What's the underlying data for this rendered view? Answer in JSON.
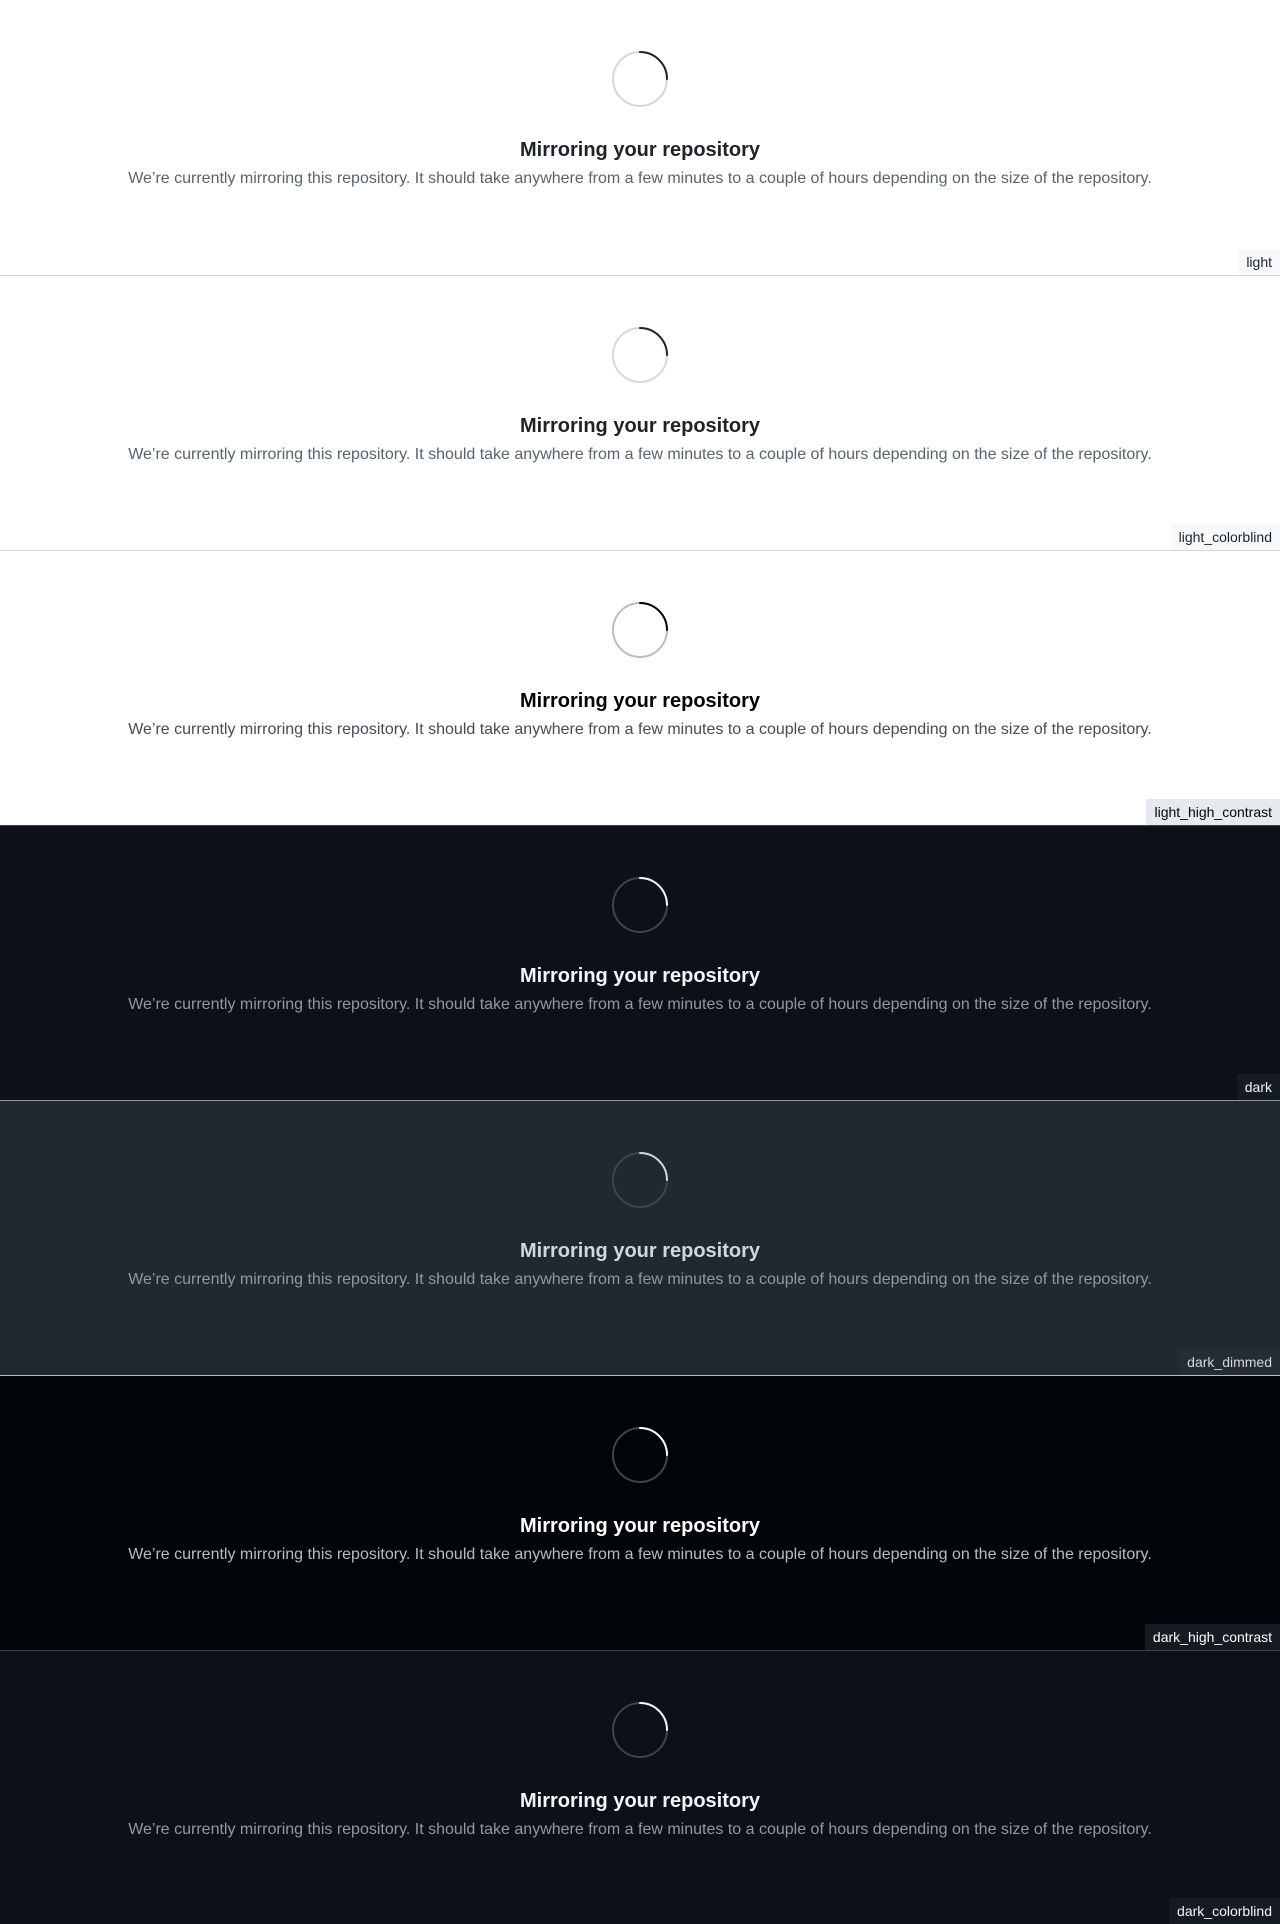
{
  "blankslate": {
    "title": "Mirroring your repository",
    "description": "We’re currently mirroring this repository. It should take anywhere from a few minutes to a couple of hours depending on the size of the repository.",
    "icon": "spinner-icon"
  },
  "themes": [
    {
      "name": "light",
      "colors": {
        "bg": "#ffffff",
        "title": "#1f2328",
        "desc": "#59636e",
        "track": "#d1d9e0",
        "arc": "#1f2328",
        "tagbg": "#f6f8fa",
        "tagfg": "#1f2328",
        "divider": "#d1d9e0"
      }
    },
    {
      "name": "light_colorblind",
      "colors": {
        "bg": "#ffffff",
        "title": "#1f2328",
        "desc": "#59636e",
        "track": "#d1d9e0",
        "arc": "#1f2328",
        "tagbg": "#f6f8fa",
        "tagfg": "#1f2328",
        "divider": "#d1d9e0"
      }
    },
    {
      "name": "light_high_contrast",
      "colors": {
        "bg": "#ffffff",
        "title": "#010409",
        "desc": "#454c54",
        "track": "#b7bdc8",
        "arc": "#010409",
        "tagbg": "#e6eaef",
        "tagfg": "#010409",
        "divider": "#d1d9e0"
      }
    },
    {
      "name": "dark",
      "colors": {
        "bg": "#0d1117",
        "title": "#f0f6fc",
        "desc": "#9198a1",
        "track": "#3d444d",
        "arc": "#f0f6fc",
        "tagbg": "#151b23",
        "tagfg": "#f0f6fc",
        "divider": "#3d444d"
      }
    },
    {
      "name": "dark_dimmed",
      "colors": {
        "bg": "#212830",
        "title": "#d1d7e0",
        "desc": "#9198a1",
        "track": "#3d444d",
        "arc": "#d1d7e0",
        "tagbg": "#262c36",
        "tagfg": "#d1d7e0",
        "divider": "#9198a1"
      }
    },
    {
      "name": "dark_high_contrast",
      "colors": {
        "bg": "#010409",
        "title": "#ffffff",
        "desc": "#b7bdc8",
        "track": "#3d444d",
        "arc": "#ffffff",
        "tagbg": "#151b23",
        "tagfg": "#ffffff",
        "divider": "#b7bdc8"
      }
    },
    {
      "name": "dark_colorblind",
      "colors": {
        "bg": "#0d1117",
        "title": "#f0f6fc",
        "desc": "#9198a1",
        "track": "#3d444d",
        "arc": "#f0f6fc",
        "tagbg": "#151b23",
        "tagfg": "#f0f6fc",
        "divider": "#3d444d"
      }
    }
  ]
}
